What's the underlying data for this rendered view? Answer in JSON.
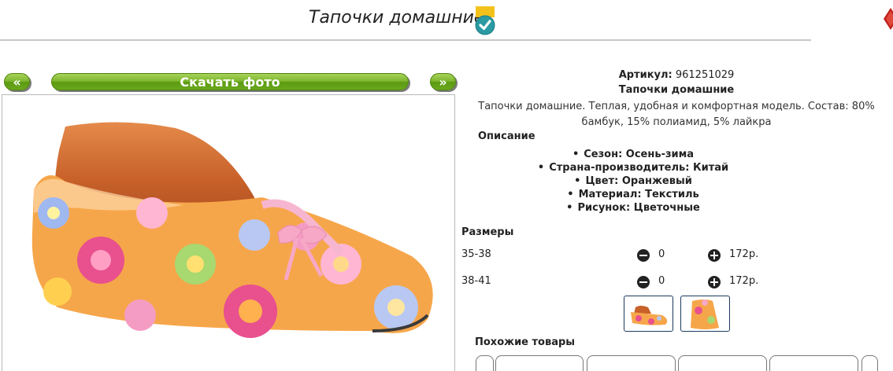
{
  "header": {
    "title": "Тапочки домашние",
    "badge_icon": "verified-check-icon",
    "corner_icon": "close-icon"
  },
  "gallery": {
    "prev_label": "«",
    "download_label": "Скачать фото",
    "next_label": "»"
  },
  "product": {
    "article_label": "Артикул:",
    "article_value": "961251029",
    "name": "Тапочки домашние",
    "description": "Тапочки домашние. Теплая, удобная и комфортная модель. Состав: 80% бамбук, 15% полиамид, 5% лайкра",
    "description_heading": "Описание",
    "properties": [
      "Сезон: Осень-зима",
      "Страна-производитель: Китай",
      "Цвет: Оранжевый",
      "Материал: Текстиль",
      "Рисунок: Цветочные"
    ]
  },
  "sizes": {
    "heading": "Размеры",
    "rows": [
      {
        "name": "35-38",
        "qty": "0",
        "price": "172р."
      },
      {
        "name": "38-41",
        "qty": "0",
        "price": "172р."
      }
    ]
  },
  "similar": {
    "heading": "Похожие товары"
  },
  "colors": {
    "accent_green": "#7cb52d",
    "slipper_orange": "#f6a64a",
    "badge_teal": "#2a9aa3",
    "badge_yellow": "#f2c21b"
  }
}
